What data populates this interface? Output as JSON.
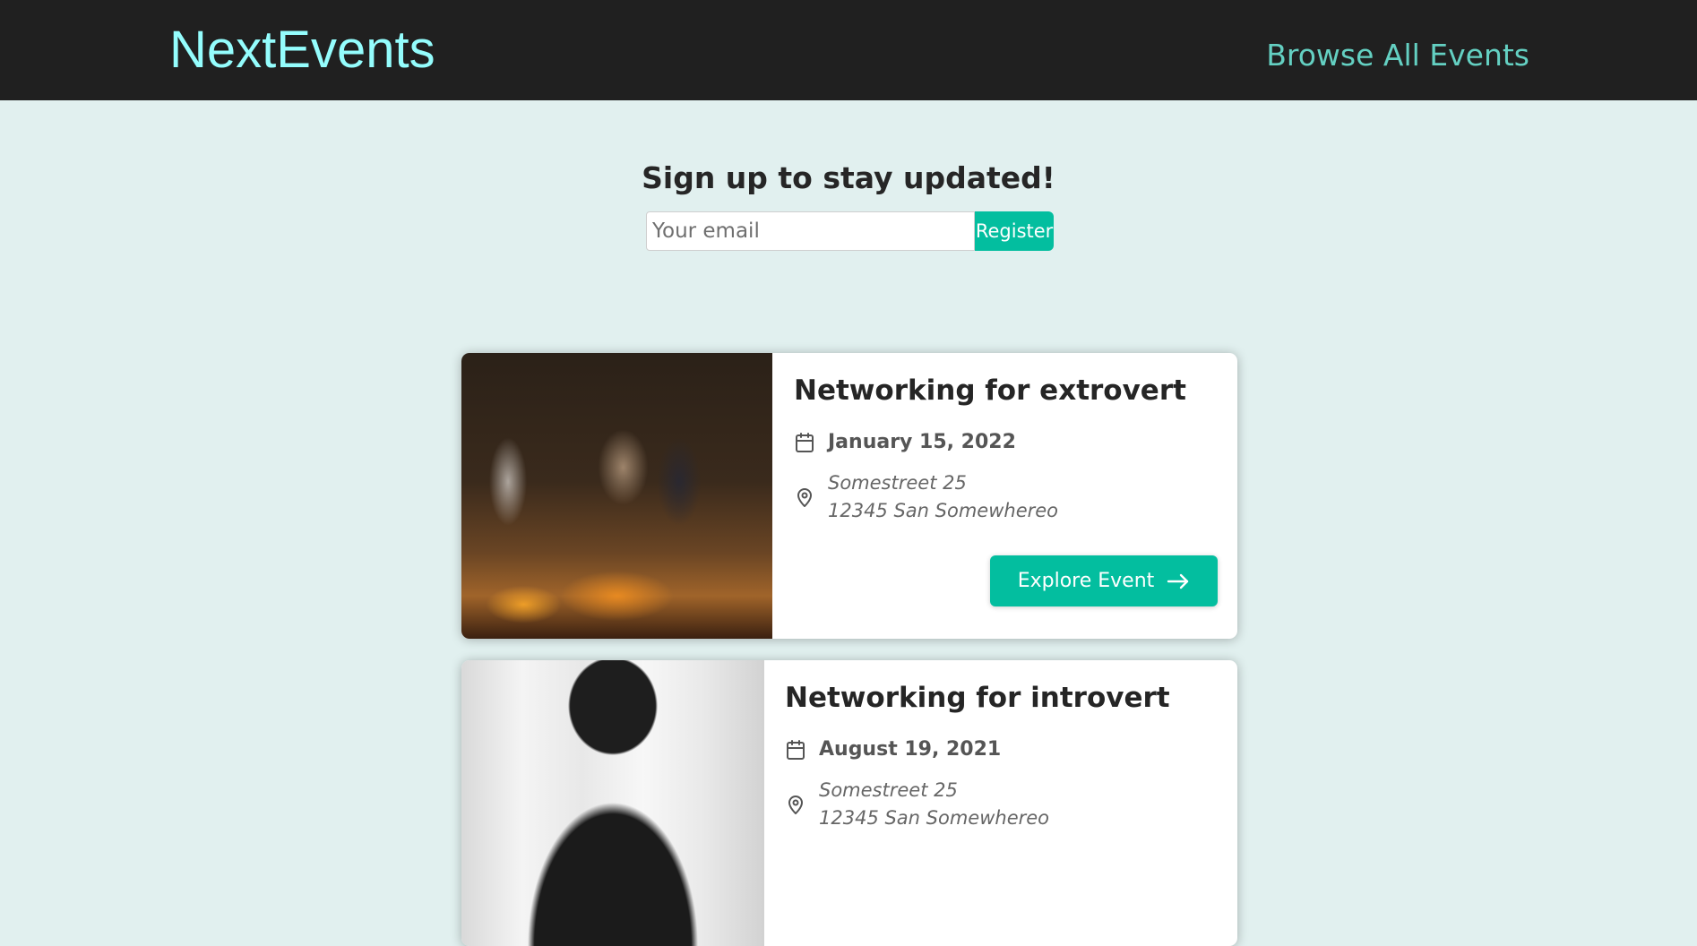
{
  "header": {
    "logo": "NextEvents",
    "nav_link": "Browse All Events"
  },
  "signup": {
    "title": "Sign up to stay updated!",
    "email_placeholder": "Your email",
    "email_value": "",
    "register_label": "Register"
  },
  "events": [
    {
      "title": "Networking for extrovert",
      "date": "January 15, 2022",
      "address_line1": "Somestreet 25",
      "address_line2": "12345 San Somewhereo",
      "button_label": "Explore Event",
      "image": "networking-party-photo"
    },
    {
      "title": "Networking for introvert",
      "date": "August 19, 2021",
      "address_line1": "Somestreet 25",
      "address_line2": "12345 San Somewhereo",
      "image": "person-silhouette-window-photo"
    }
  ],
  "icons": {
    "date": "calendar-icon",
    "address": "map-pin-icon",
    "explore": "arrow-right-icon"
  },
  "colors": {
    "header_bg": "#202020",
    "logo": "#94fdfd",
    "nav_link": "#64d0c2",
    "page_bg": "#e1f0ef",
    "accent": "#03be9f"
  }
}
